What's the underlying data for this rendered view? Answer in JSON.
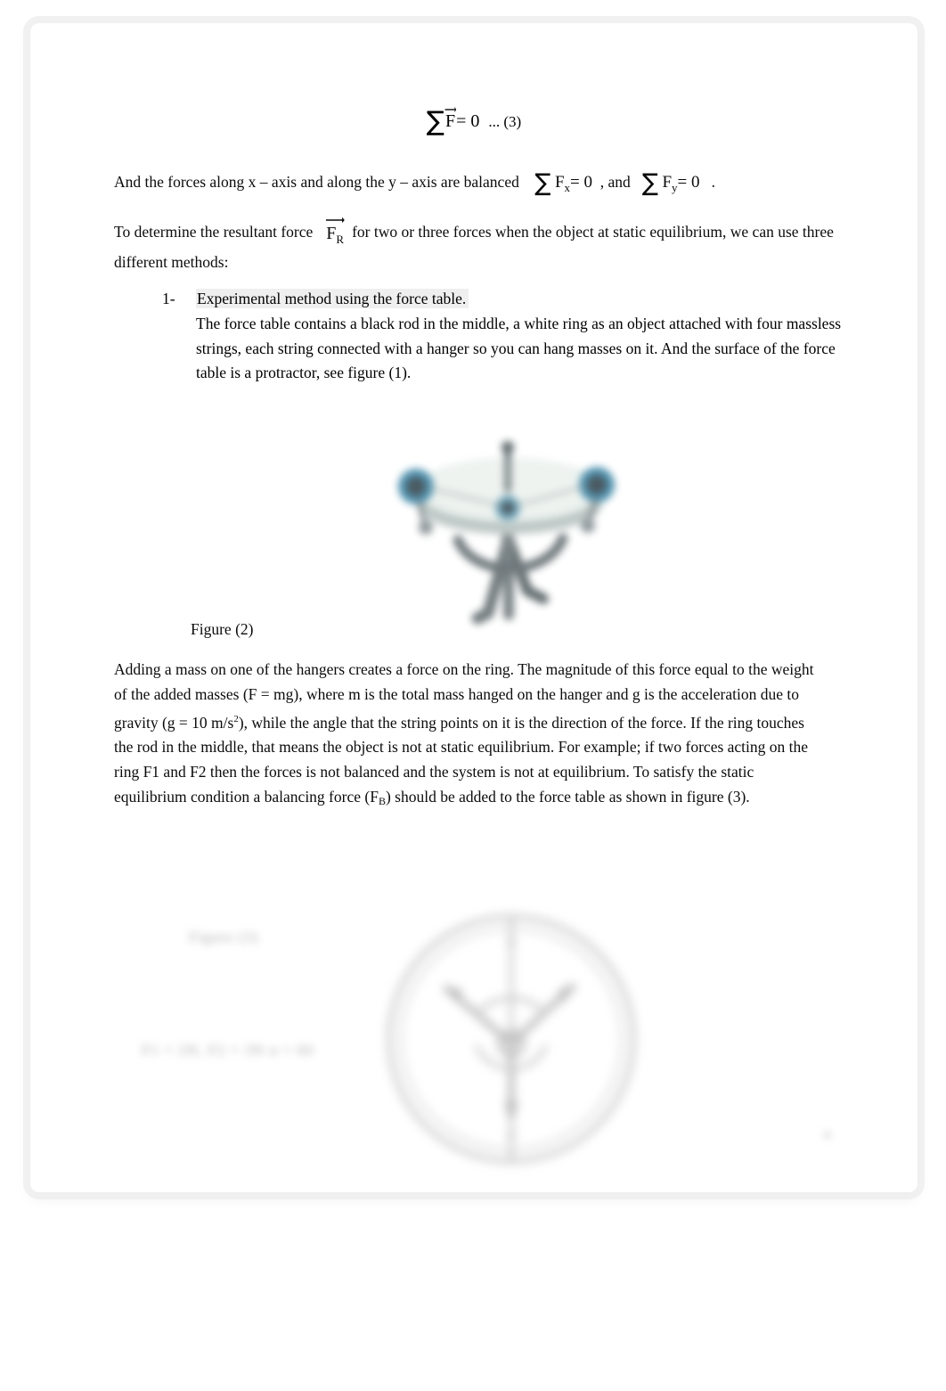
{
  "document": {
    "page_background": "#ffffff",
    "sheet_color": "#ffffff",
    "text_color": "#0b0b0b",
    "highlight_color": "#efefef"
  },
  "equations": {
    "sum_f_zero": {
      "sigma": "∑",
      "symbol": "F",
      "equals": "= 0",
      "number_note": "... (3)"
    },
    "sum_fx": {
      "sigma": "∑",
      "symbol": "F",
      "subscript": "x",
      "equals": "= 0"
    },
    "sum_fy": {
      "sigma": "∑",
      "symbol": "F",
      "subscript": "y",
      "equals": "= 0"
    },
    "f_resultant": {
      "symbol": "F",
      "subscript": "R"
    }
  },
  "paragraphs": {
    "balanced_lead": "And the forces along x – axis and along the y – axis are balanced",
    "balanced_mid": ", and",
    "balanced_end": ".",
    "resultant_lead": "To determine the resultant force",
    "resultant_tail": "for two or three forces when the object at static equilibrium, we can use three different methods:",
    "adding_mass": "Adding a mass on one of the hangers creates a force on the ring. The magnitude of this force equal to the weight of the added masses (F = mg), where m is the total mass hanged on the hanger and g is the acceleration due to gravity (g = 10 m/s",
    "adding_mass_2": "), while the angle that the string points on it is the direction of the force. If the ring touches the rod in the middle, that means the object is not at static equilibrium. For example; if two forces acting on the ring F1 and F2 then the forces is not balanced and the system is not at equilibrium. To satisfy the static equilibrium condition a balancing force (F",
    "adding_mass_3": ") should be added to the force table as shown in figure (3).",
    "superscript_two": "2",
    "subscript_b": "B"
  },
  "list": {
    "items": [
      {
        "marker": "1-",
        "heading": "Experimental method using the force table.",
        "body": "The force table contains a black rod in the middle, a white ring as an object attached with four massless strings, each string connected with a hanger so you can hang masses on it. And the surface of the force table is a protractor, see figure (1)."
      }
    ]
  },
  "figures": {
    "figure2": {
      "caption": "Figure (2)",
      "alt": "force-table-photo",
      "colors": {
        "table_top": "#e7edea",
        "table_edge": "#b9c4c2",
        "pulley_accent": "#4b90ae",
        "metal_dark": "#5a6568",
        "stand": "#6b7478"
      }
    },
    "figure3": {
      "alt": "protractor-force-diagram",
      "colors": {
        "circle_outline": "#b8b8b8",
        "vectors": "#9a9a9a"
      }
    }
  },
  "ghost_marks": {
    "label_top": "Figure (3)",
    "label_bottom": "F1 = 2N, F2 = 3N       α = 60",
    "corner_mark": "●"
  }
}
